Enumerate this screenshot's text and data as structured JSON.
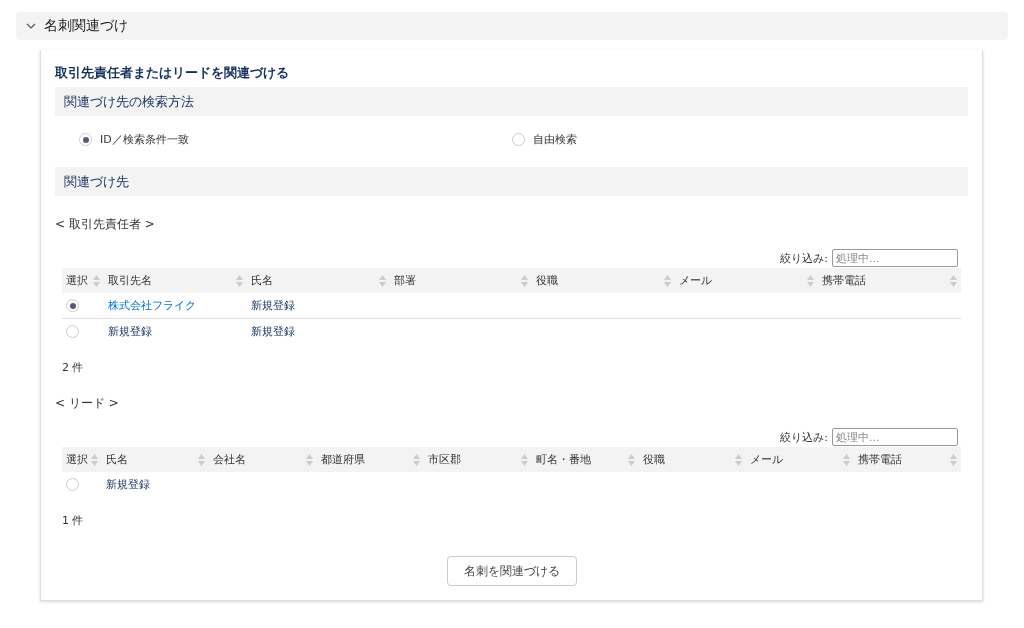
{
  "section": {
    "title": "名刺関連づけ",
    "expanded": true
  },
  "heading": "取引先責任者またはリードを関連づける",
  "search_method": {
    "title": "関連づけ先の検索方法",
    "options": [
      {
        "label": "ID／検索条件一致",
        "selected": true
      },
      {
        "label": "自由検索",
        "selected": false
      }
    ]
  },
  "targets": {
    "title": "関連づけ先",
    "tables": [
      {
        "caption": "< 取引先責任者 >",
        "filter_label": "絞り込み:",
        "filter_placeholder": "処理中...",
        "columns": [
          "選択",
          "取引先名",
          "氏名",
          "部署",
          "役職",
          "メール",
          "携帯電話"
        ],
        "rows": [
          {
            "cells": [
              {
                "kind": "radio",
                "selected": true
              },
              {
                "kind": "text",
                "text": "株式会社フライク",
                "link": true
              },
              {
                "kind": "text",
                "text": "新規登録",
                "link": false
              }
            ]
          },
          {
            "cells": [
              {
                "kind": "radio",
                "selected": false
              },
              {
                "kind": "text",
                "text": "新規登録",
                "link": false
              },
              {
                "kind": "text",
                "text": "新規登録",
                "link": false
              }
            ]
          }
        ],
        "count": "2 件"
      },
      {
        "caption": "< リード >",
        "filter_label": "絞り込み:",
        "filter_placeholder": "処理中...",
        "columns": [
          "選択",
          "氏名",
          "会社名",
          "都道府県",
          "市区郡",
          "町名・番地",
          "役職",
          "メール",
          "携帯電話"
        ],
        "rows": [
          {
            "cells": [
              {
                "kind": "radio",
                "selected": false
              },
              {
                "kind": "text",
                "text": "新規登録",
                "link": false
              }
            ]
          }
        ],
        "count": "1 件"
      }
    ]
  },
  "button": "名刺を関連づける"
}
